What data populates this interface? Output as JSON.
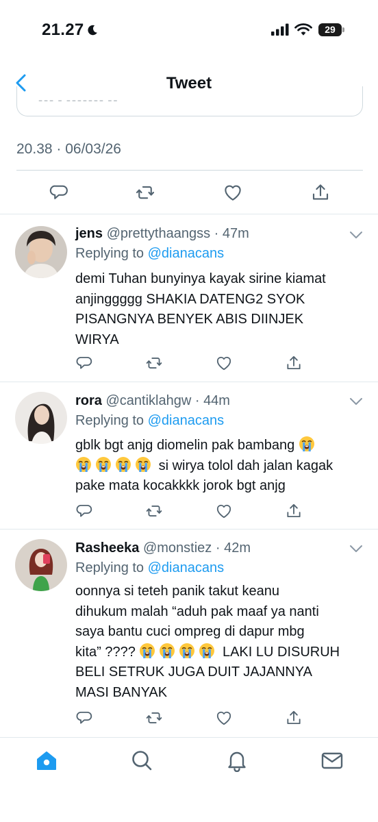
{
  "status_bar": {
    "time": "21.27",
    "battery": "29"
  },
  "nav": {
    "title": "Tweet"
  },
  "tweet": {
    "timestamp": "20.38 · 06/03/26"
  },
  "replies": [
    {
      "name": "jens",
      "handle": "@prettythaangss",
      "age": "47m",
      "replying_label": "Replying to",
      "replying_to": "@dianacans",
      "lines": [
        "demi Tuhan bunyinya kayak sirine kiamat",
        "anjinggggg SHAKIA DATENG2 SYOK",
        "PISANGNYA BENYEK ABIS DIINJEK",
        "WIRYA"
      ]
    },
    {
      "name": "rora",
      "handle": "@cantiklahgw",
      "age": "44m",
      "replying_label": "Replying to",
      "replying_to": "@dianacans",
      "line1": "gblk bgt anjg diomelin pak bambang",
      "line2": "si wirya tolol dah jalan kagak",
      "line3": "pake mata kocakkkk jorok bgt anjg"
    },
    {
      "name": "Rasheeka",
      "handle": "@monstiez",
      "age": "42m",
      "replying_label": "Replying to",
      "replying_to": "@dianacans",
      "line1": "oonnya si teteh panik takut keanu",
      "line2": "dihukum malah “aduh pak maaf ya nanti",
      "line3": "saya bantu cuci ompreg di dapur mbg",
      "line4a": "kita” ????",
      "line4b": "LAKI LU DISURUH",
      "line5": "BELI SETRUK JUGA DUIT JAJANNYA",
      "line6": "MASI BANYAK"
    }
  ],
  "icons": {
    "reply": "reply-icon",
    "retweet": "retweet-icon",
    "like": "heart-icon",
    "share": "share-icon",
    "emoji": "loudly-crying-face-emoji"
  },
  "colors": {
    "accent": "#1d9bf0",
    "text": "#0f1419",
    "muted": "#536471",
    "divider": "#e1e8ed"
  }
}
